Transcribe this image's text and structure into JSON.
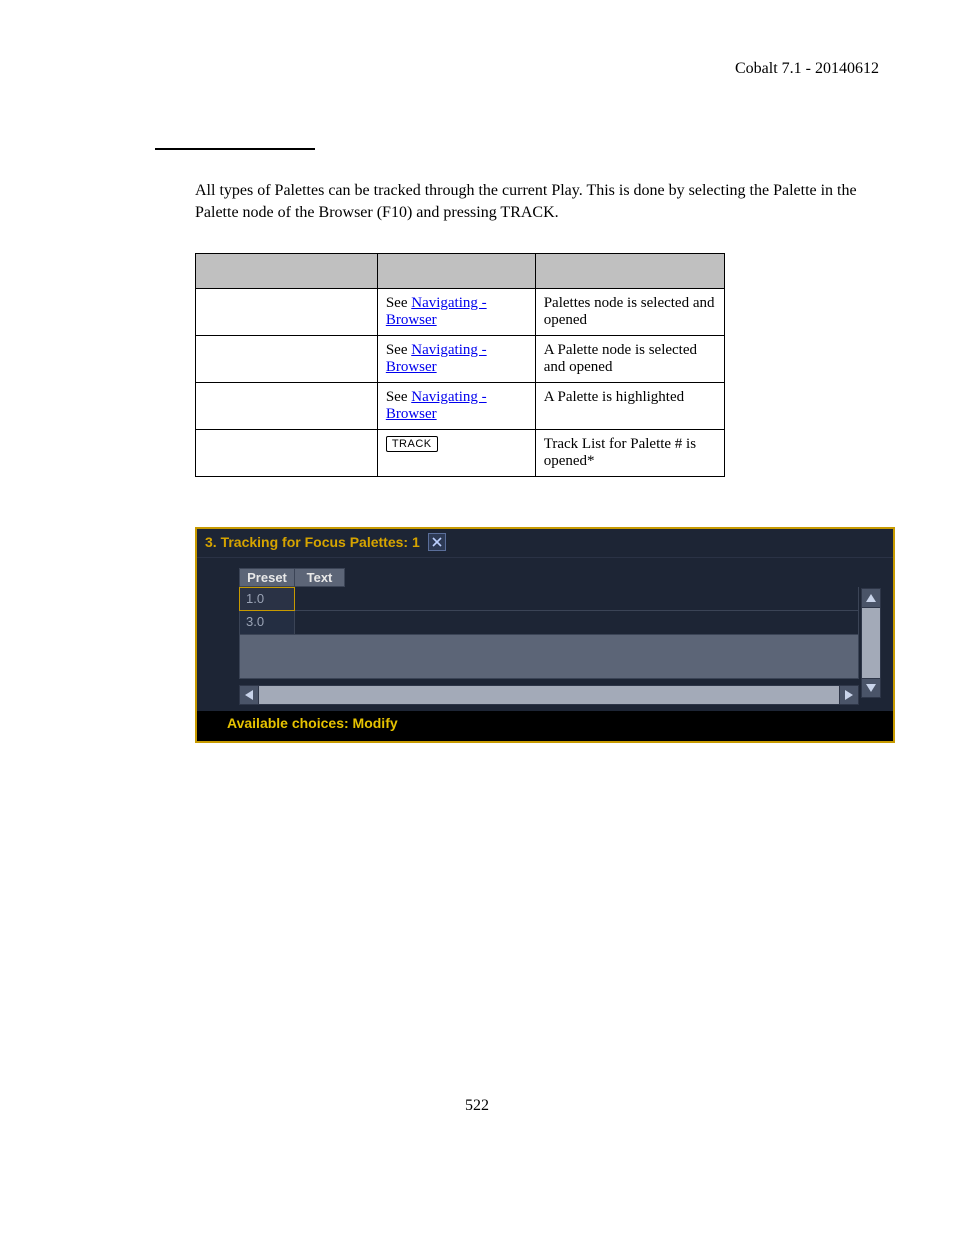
{
  "header": {
    "text": "Cobalt 7.1 - 20140612"
  },
  "intro": "All types of Palettes can be tracked through the current Play. This is done by selecting the Palette in the Palette node of the Browser (F10) and pressing TRACK.",
  "table": {
    "headers": [
      "",
      "",
      ""
    ],
    "rows": [
      {
        "action": "",
        "see": "See ",
        "link": "Navigating - Browser",
        "feedback": "Palettes node is selected and opened"
      },
      {
        "action": "",
        "see": "See ",
        "link": "Navigating - Browser",
        "feedback": "A Palette node is selected and opened"
      },
      {
        "action": "",
        "see": "See ",
        "link": "Navigating - Browser",
        "feedback": "A Palette is highlighted"
      },
      {
        "action": "",
        "key": "TRACK",
        "feedback": "Track List for Palette # is opened*"
      }
    ]
  },
  "panel": {
    "title": "3. Tracking for Focus Palettes: 1",
    "columns": {
      "preset": "Preset",
      "text": "Text"
    },
    "rows": [
      {
        "preset": "1.0",
        "text": ""
      },
      {
        "preset": "3.0",
        "text": ""
      }
    ],
    "footer": "Available choices: Modify"
  },
  "pageNumber": "522"
}
